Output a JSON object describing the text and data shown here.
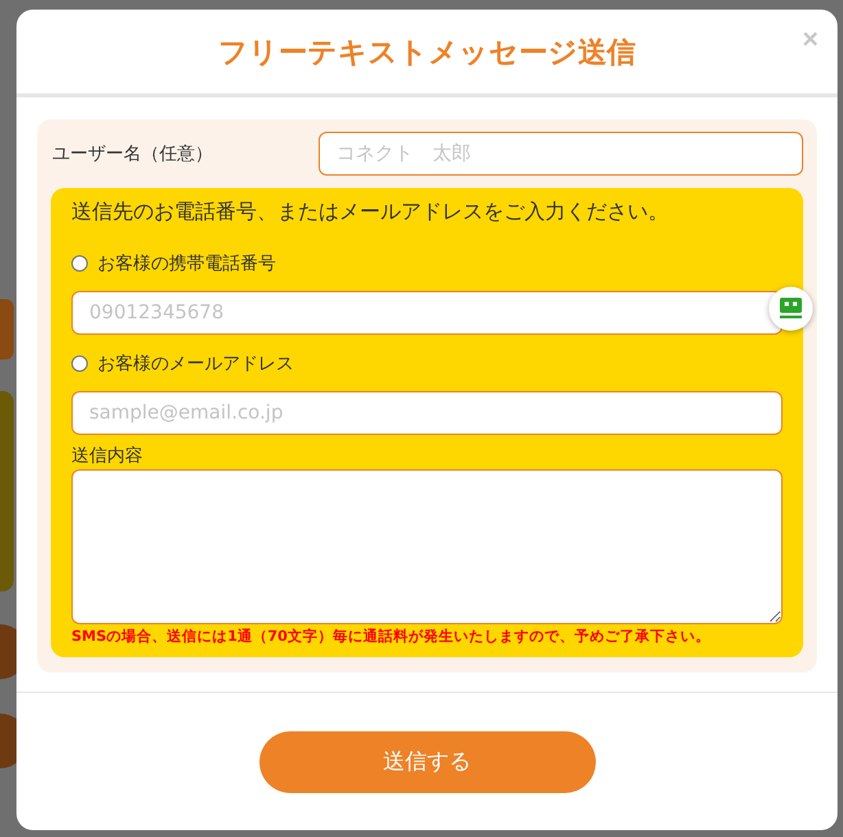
{
  "dialog": {
    "title": "フリーテキストメッセージ送信",
    "close": "×"
  },
  "user_name": {
    "label": "ユーザー名（任意）",
    "placeholder": "コネクト　太郎"
  },
  "destination": {
    "instruction": "送信先のお電話番号、またはメールアドレスをご入力ください。",
    "options": [
      {
        "label": "お客様の携帯電話番号",
        "selected": false,
        "placeholder": "09012345678"
      },
      {
        "label": "お客様のメールアドレス",
        "selected": false,
        "placeholder": "sample@email.co.jp"
      }
    ],
    "message_label": "送信内容",
    "notice": "SMSの場合、送信には1通（70文字）毎に通話料が発生いたしますので、予めご了承下さい。"
  },
  "submit": "送信する"
}
